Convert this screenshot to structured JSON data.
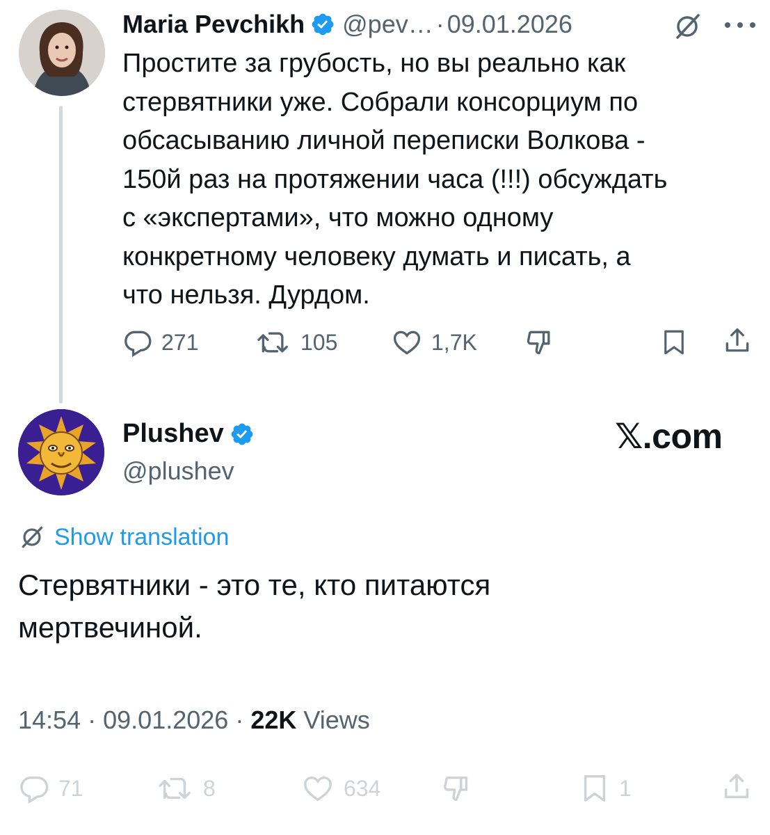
{
  "parent_tweet": {
    "author_name": "Maria Pevchikh",
    "handle": "@pev…",
    "separator": "·",
    "date": "09.01.2026",
    "text": "Простите за грубость, но вы реально как\nстервятники уже. Собрали консорциум по\nобсасыванию личной переписки Волкова -\n150й раз на протяжении часа (!!!) обсуждать\nс «экспертами», что можно одному\nконкретному человеку думать и писать, а\nчто нельзя. Дурдом.",
    "replies": "271",
    "reposts": "105",
    "likes": "1,7K",
    "icons": [
      "reply-icon",
      "repost-icon",
      "like-icon",
      "dislike-icon",
      "bookmark-icon",
      "share-icon",
      "translate-icon",
      "more-icon"
    ]
  },
  "main_tweet": {
    "author_name": "Plushev",
    "handle": "@plushev",
    "watermark": "𝕏.com",
    "show_translation": "Show translation",
    "text": "Стервятники - это те, кто питаются\nмертвечиной.",
    "time": "14:54",
    "separator": "·",
    "date": "09.01.2026",
    "views_count": "22K",
    "views_label": "Views",
    "replies": "71",
    "reposts": "8",
    "likes": "634",
    "bookmarks": "1"
  },
  "colors": {
    "verified": "#1d9bf0",
    "link": "#1d9bf0",
    "secondary_text": "#536471",
    "primary_text": "#0f1419",
    "thread_line": "#cfd9de"
  }
}
